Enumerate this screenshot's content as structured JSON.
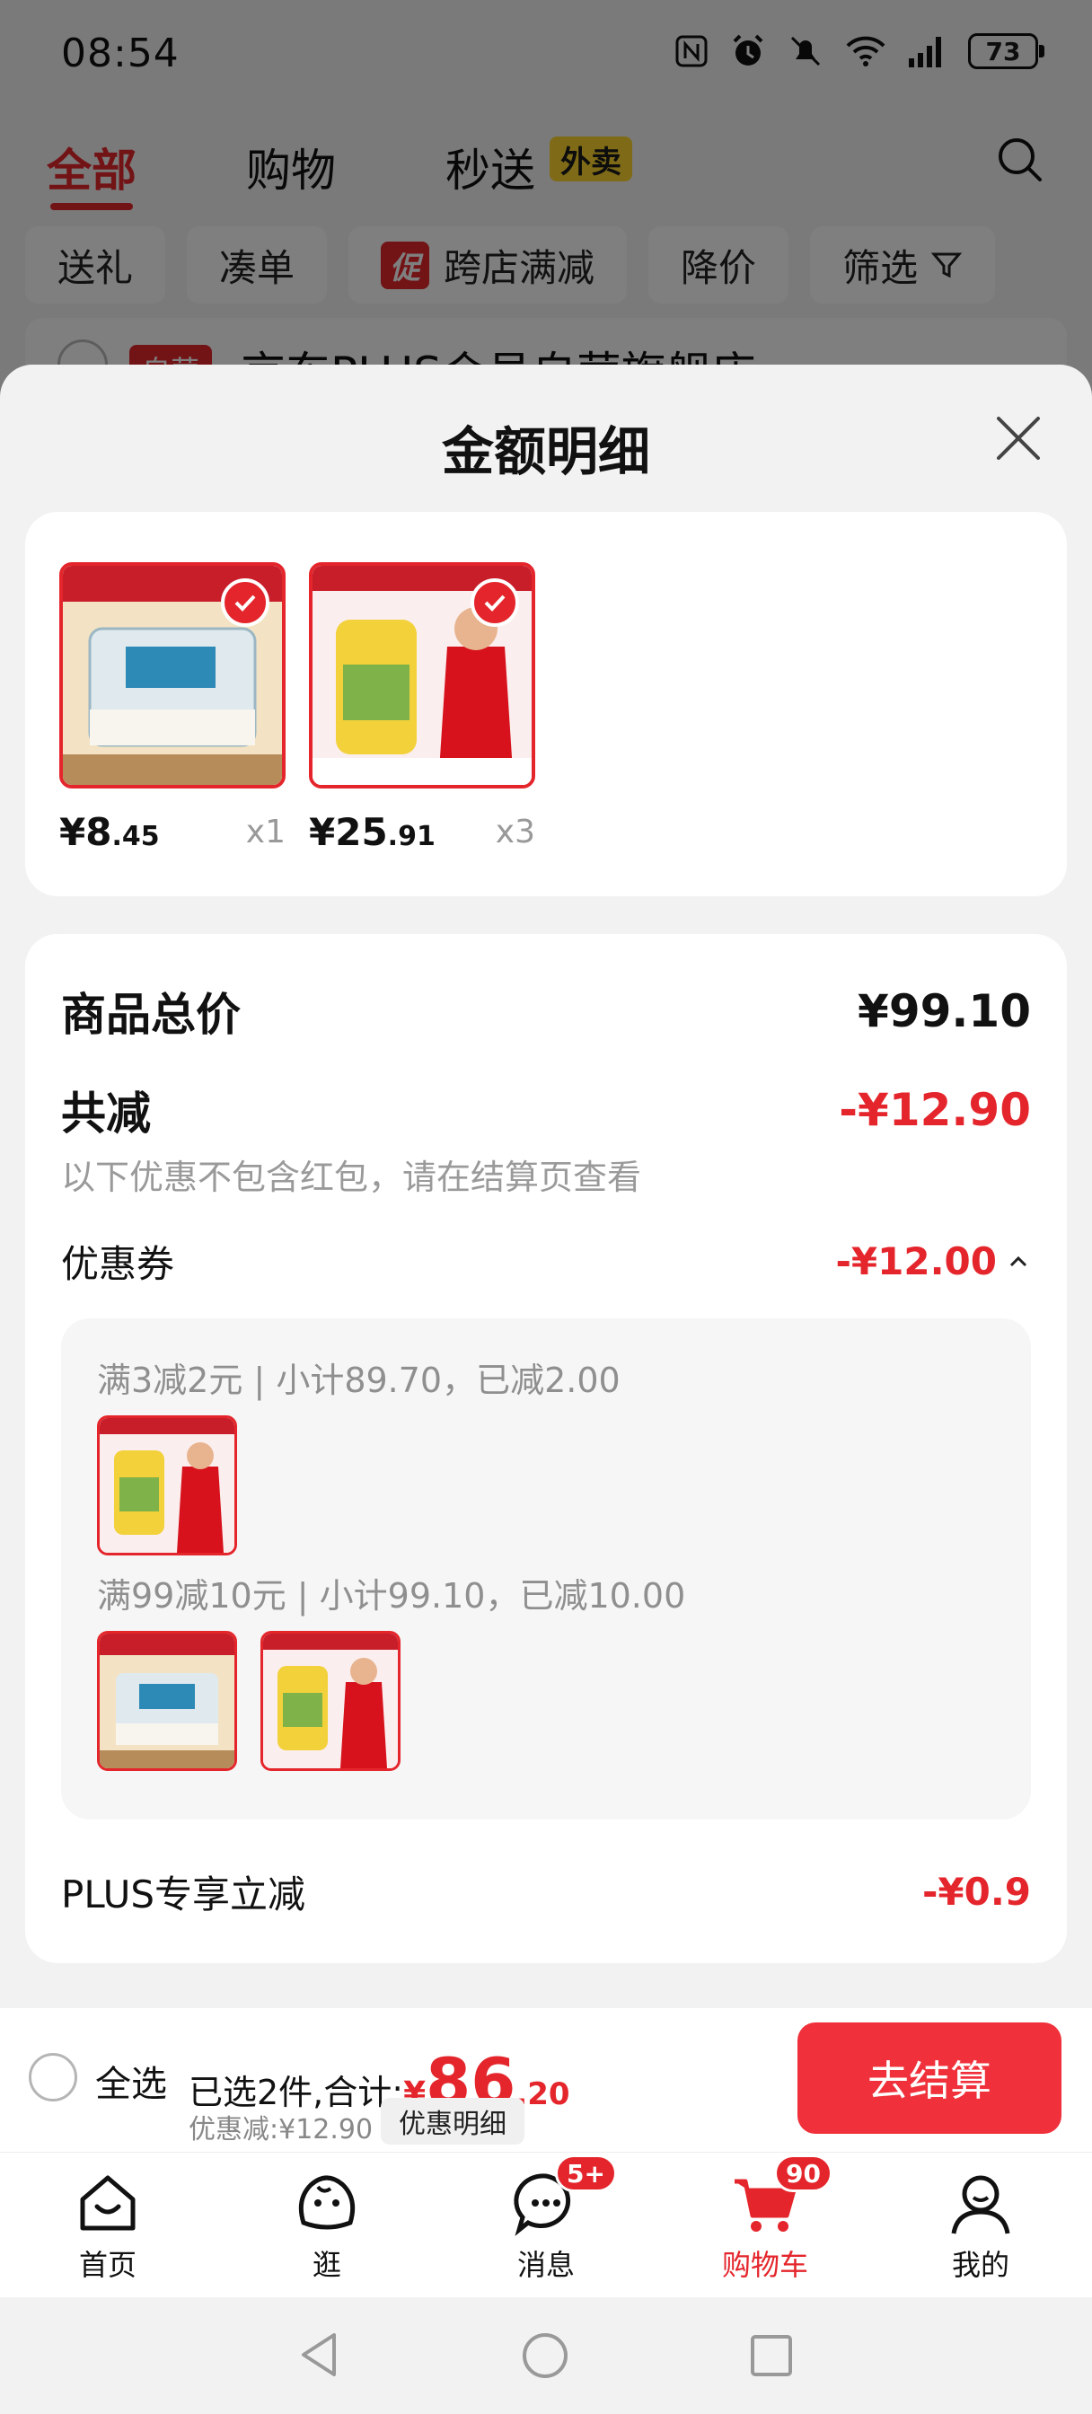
{
  "status_bar": {
    "time": "08:54",
    "battery": "73"
  },
  "top_nav": {
    "tabs": [
      {
        "label": "全部",
        "active": true
      },
      {
        "label": "购物",
        "active": false
      },
      {
        "label": "秒送",
        "active": false
      }
    ],
    "waimai_badge": "外卖"
  },
  "filters": {
    "items": [
      "送礼",
      "凑单",
      "跨店满减",
      "降价",
      "筛选"
    ],
    "promo_tag": "促"
  },
  "store_peek": {
    "tag": "自营",
    "name": "京东PLUS会员自营旗舰店 ›"
  },
  "sheet": {
    "title": "金额明细",
    "products": [
      {
        "price_int": "¥8",
        "price_dec": ".45",
        "qty": "x1",
        "image": "rice-noodle-product"
      },
      {
        "price_int": "¥25",
        "price_dec": ".91",
        "qty": "x3",
        "image": "cooking-oil-product"
      }
    ],
    "summary": {
      "total_label": "商品总价",
      "total_value": "¥99.10",
      "reduce_label": "共减",
      "reduce_value": "-¥12.90",
      "note": "以下优惠不包含红包，请在结算页查看",
      "coupon_label": "优惠券",
      "coupon_value": "-¥12.00",
      "coupon_rules": [
        {
          "text": "满3减2元 | 小计89.70，已减2.00",
          "images": [
            "cooking-oil-product"
          ]
        },
        {
          "text": "满99减10元 | 小计99.10，已减10.00",
          "images": [
            "rice-noodle-product",
            "cooking-oil-product"
          ]
        }
      ],
      "plus_label": "PLUS专享立减",
      "plus_value": "-¥0.9"
    }
  },
  "cart_bar": {
    "select_all": "全选",
    "selected_text": "已选2件,合计:",
    "yen": "¥",
    "total_int": "86",
    "total_dec": ".20",
    "discount_text": "优惠减:¥12.90",
    "detail_button": "优惠明细",
    "checkout_button": "去结算"
  },
  "tab_bar": {
    "items": [
      {
        "label": "首页",
        "icon": "home-icon"
      },
      {
        "label": "逛",
        "icon": "browse-icon"
      },
      {
        "label": "消息",
        "icon": "message-icon",
        "badge": "5+"
      },
      {
        "label": "购物车",
        "icon": "cart-icon",
        "badge": "90",
        "active": true
      },
      {
        "label": "我的",
        "icon": "profile-icon"
      }
    ]
  },
  "colors": {
    "accent": "#e4262c",
    "checkout": "#f0303a",
    "badge_yellow": "#ffd62e"
  }
}
